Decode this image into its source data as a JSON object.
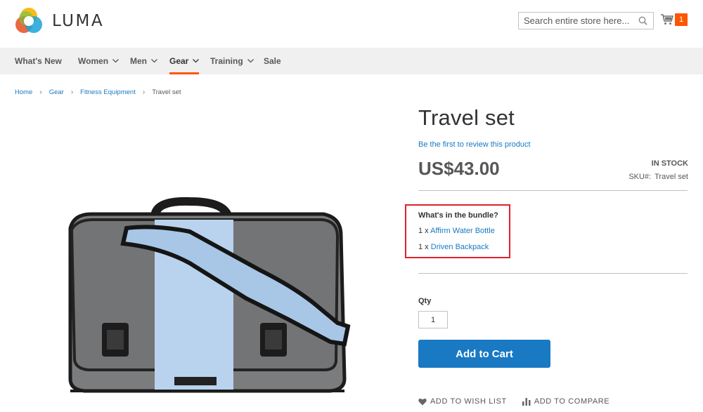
{
  "brand": {
    "name": "LUMA"
  },
  "search": {
    "placeholder": "Search entire store here..."
  },
  "cart": {
    "count": "1"
  },
  "nav": {
    "items": [
      {
        "label": "What's New"
      },
      {
        "label": "Women"
      },
      {
        "label": "Men"
      },
      {
        "label": "Gear"
      },
      {
        "label": "Training"
      },
      {
        "label": "Sale"
      }
    ]
  },
  "breadcrumb": {
    "items": [
      "Home",
      "Gear",
      "Fitness Equipment"
    ],
    "current": "Travel set"
  },
  "product": {
    "title": "Travel set",
    "review_link": "Be the first to review this product",
    "price": "US$43.00",
    "stock": "IN STOCK",
    "sku_label": "SKU#:",
    "sku_value": "Travel set",
    "bundle_title": "What's in the bundle?",
    "bundle_items": [
      {
        "qty": "1 x",
        "name": "Affirm Water Bottle"
      },
      {
        "qty": "1 x",
        "name": "Driven Backpack"
      }
    ],
    "qty_label": "Qty",
    "qty_value": "1",
    "add_to_cart": "Add to Cart",
    "wishlist": "ADD TO WISH LIST",
    "compare": "ADD TO COMPARE"
  },
  "colors": {
    "accent_orange": "#ff5501",
    "link_blue": "#1979c3",
    "highlight_red": "#e0202a"
  },
  "icons": [
    "luma-logo-icon",
    "search-icon",
    "cart-icon",
    "chevron-down-icon",
    "heart-icon",
    "compare-bars-icon"
  ]
}
